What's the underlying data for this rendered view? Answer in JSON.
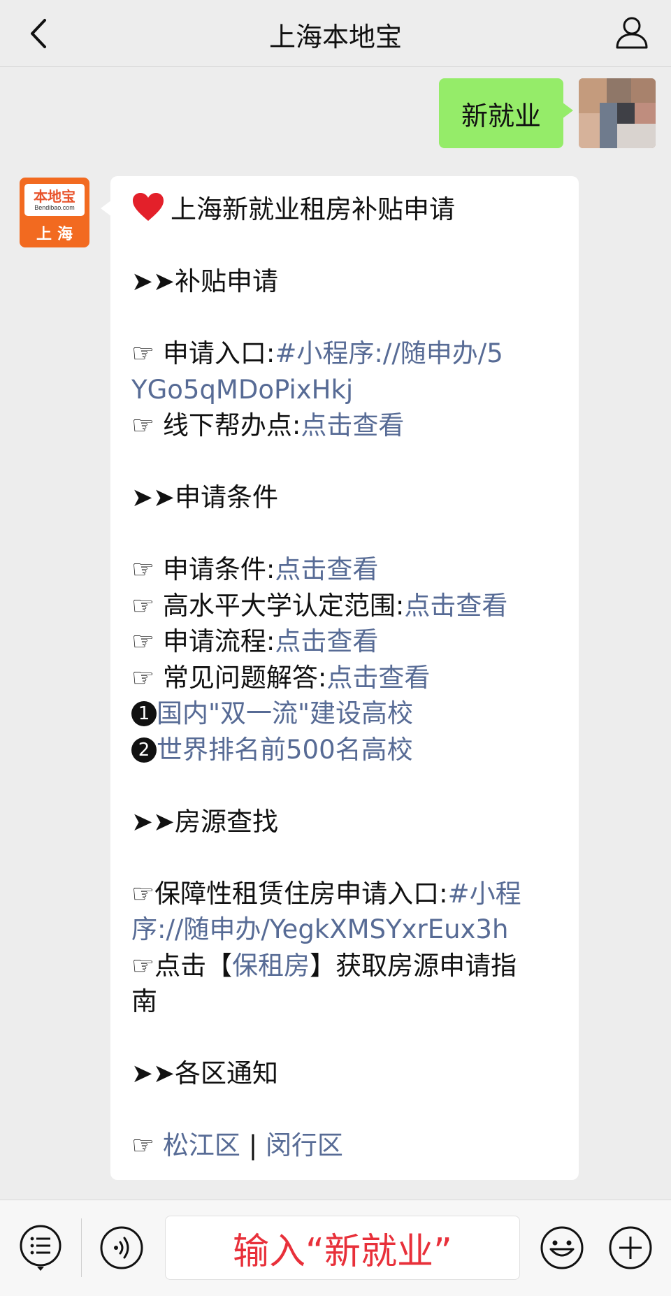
{
  "header": {
    "title": "上海本地宝"
  },
  "outgoing": {
    "text": "新就业"
  },
  "bot": {
    "avatar_brand": "本地宝",
    "avatar_domain": "Bendibao.com",
    "avatar_city": "上海"
  },
  "message": {
    "title": "上海新就业租房补贴申请",
    "s1_heading": "➤➤补贴申请",
    "s1_l1_label": "☞ 申请入口:",
    "s1_l1_link_a": "#小程序://随申办/5",
    "s1_l1_link_b": "YGo5qMDoPixHkj",
    "s1_l2_label": "☞ 线下帮办点:",
    "s1_l2_link": "点击查看",
    "s2_heading": "➤➤申请条件",
    "s2_l1_label": "☞ 申请条件:",
    "s2_l1_link": "点击查看",
    "s2_l2_label": "☞ 高水平大学认定范围:",
    "s2_l2_link": "点击查看",
    "s2_l3_label": "☞ 申请流程:",
    "s2_l3_link": "点击查看",
    "s2_l4_label": "☞ 常见问题解答:",
    "s2_l4_link": "点击查看",
    "s2_n1_mark": "1",
    "s2_n1_link": "国内\"双一流\"建设高校",
    "s2_n2_mark": "2",
    "s2_n2_link": "世界排名前500名高校",
    "s3_heading": "➤➤房源查找",
    "s3_l1_label": "☞保障性租赁住房申请入口:",
    "s3_l1_link_a": "#小程",
    "s3_l1_link_b": "序://随申办/YegkXMSYxrEux3h",
    "s3_l2_pre": "☞点击【",
    "s3_l2_link": "保租房",
    "s3_l2_post": "】获取房源申请指",
    "s3_l2_tail": "南",
    "s4_heading": "➤➤各区通知",
    "s4_prefix": "☞ ",
    "s4_link1": "松江区",
    "s4_sep": " | ",
    "s4_link2": "闵行区"
  },
  "input": {
    "hint": "输入“新就业”"
  },
  "colors": {
    "link": "#576b95",
    "outgoing_bubble": "#95ec69",
    "brand_orange": "#f26a20",
    "hint_red": "#e8303a"
  },
  "icons": {
    "back": "chevron-left-icon",
    "profile": "person-icon",
    "menu": "list-icon",
    "voice": "voice-icon",
    "emoji": "smiley-icon",
    "plus": "plus-icon"
  }
}
